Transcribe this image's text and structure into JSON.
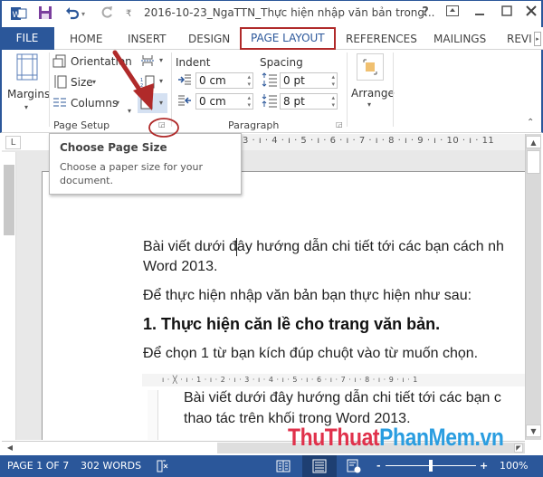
{
  "window": {
    "title": "2016-10-23_NgaTTN_Thực hiện nhập văn bản trong...",
    "controls": [
      "?",
      "ribbon-display",
      "minimize",
      "maximize",
      "close"
    ]
  },
  "quick_access": {
    "icons": [
      "word-logo-icon",
      "save-icon",
      "undo-icon",
      "redo-icon",
      "customize-icon"
    ]
  },
  "tabs": [
    {
      "label": "FILE"
    },
    {
      "label": "HOME"
    },
    {
      "label": "INSERT"
    },
    {
      "label": "DESIGN"
    },
    {
      "label": "PAGE LAYOUT",
      "active": true,
      "highlighted": true
    },
    {
      "label": "REFERENCES"
    },
    {
      "label": "MAILINGS"
    },
    {
      "label": "REVI"
    }
  ],
  "ribbon": {
    "page_setup": {
      "label": "Page Setup",
      "margins": "Margins",
      "orientation": "Orientation",
      "size": "Size",
      "columns": "Columns"
    },
    "paragraph": {
      "label": "Paragraph",
      "indent_label": "Indent",
      "spacing_label": "Spacing",
      "indent_left": "0 cm",
      "indent_right": "0 cm",
      "spacing_before": "0 pt",
      "spacing_after": "8 pt"
    },
    "arrange": {
      "label": "Arrange"
    }
  },
  "tooltip": {
    "title": "Choose Page Size",
    "description": "Choose a paper size for your document."
  },
  "ruler": {
    "corner": "L",
    "left_number": "3",
    "ticks": "3 · ı · 4 · ı · 5 · ı · 6 · ı · 7 · ı · 8 · ı · 9 · ı · 10 · ı · 11"
  },
  "document": {
    "paragraphs": [
      "Bài viết dưới đây hướng dẫn chi tiết tới các bạn cách nh",
      "Word 2013.",
      "Để thực hiện nhập văn bản bạn thực hiện như sau:"
    ],
    "heading": "1. Thực hiện căn lề cho trang văn bản.",
    "paragraph_after_heading": "Để chọn 1 từ bạn kích đúp chuột vào từ muốn chọn.",
    "nested_screenshot": {
      "ruler": "ı · ╳ · ı · 1 · ı · 2 · ı · 3 · ı · 4 · ı · 5 · ı · 6 · ı · 7 · ı · 8 · ı · 9 · ı · 1",
      "line1": "Bài viết dưới đây hướng dẫn chi tiết tới các bạn c",
      "line2": "thao tác trên khối trong Word 2013."
    }
  },
  "watermark": {
    "part1": "ThuThuat",
    "part2": "PhanMem",
    "part3": ".vn",
    "color1": "#e0314b",
    "color2": "#2a9de0"
  },
  "status_bar": {
    "page": "PAGE 1 OF 7",
    "words": "302 WORDS",
    "zoom_minus": "-",
    "zoom_plus": "+",
    "zoom_level": "100%",
    "zoom_slider_value": 0.5
  },
  "colors": {
    "accent": "#2b579a",
    "annotation": "#b02a2a"
  }
}
